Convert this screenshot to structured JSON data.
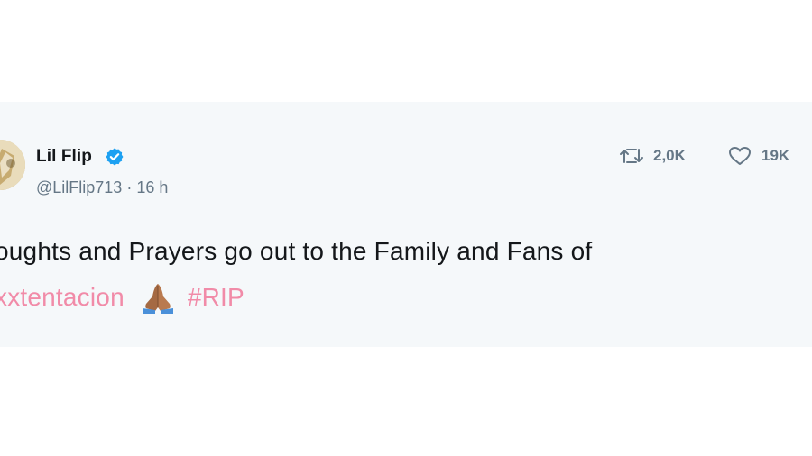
{
  "tweet": {
    "author": {
      "display_name": "Lil Flip",
      "handle": "@LilFlip713",
      "separator": "·",
      "time": "16 h",
      "verified_color": "#1da1f2"
    },
    "stats": {
      "retweets": "2,0K",
      "likes": "19K"
    },
    "text": {
      "line1": "oughts and Prayers go out to the Family and Fans of",
      "mention": "xxtentacion",
      "emoji": "folded-hands",
      "hashtag": "#RIP"
    }
  },
  "colors": {
    "card_background": "#f5f8fa",
    "link": "#f18ba8",
    "muted": "#657786",
    "text": "#14171a"
  }
}
